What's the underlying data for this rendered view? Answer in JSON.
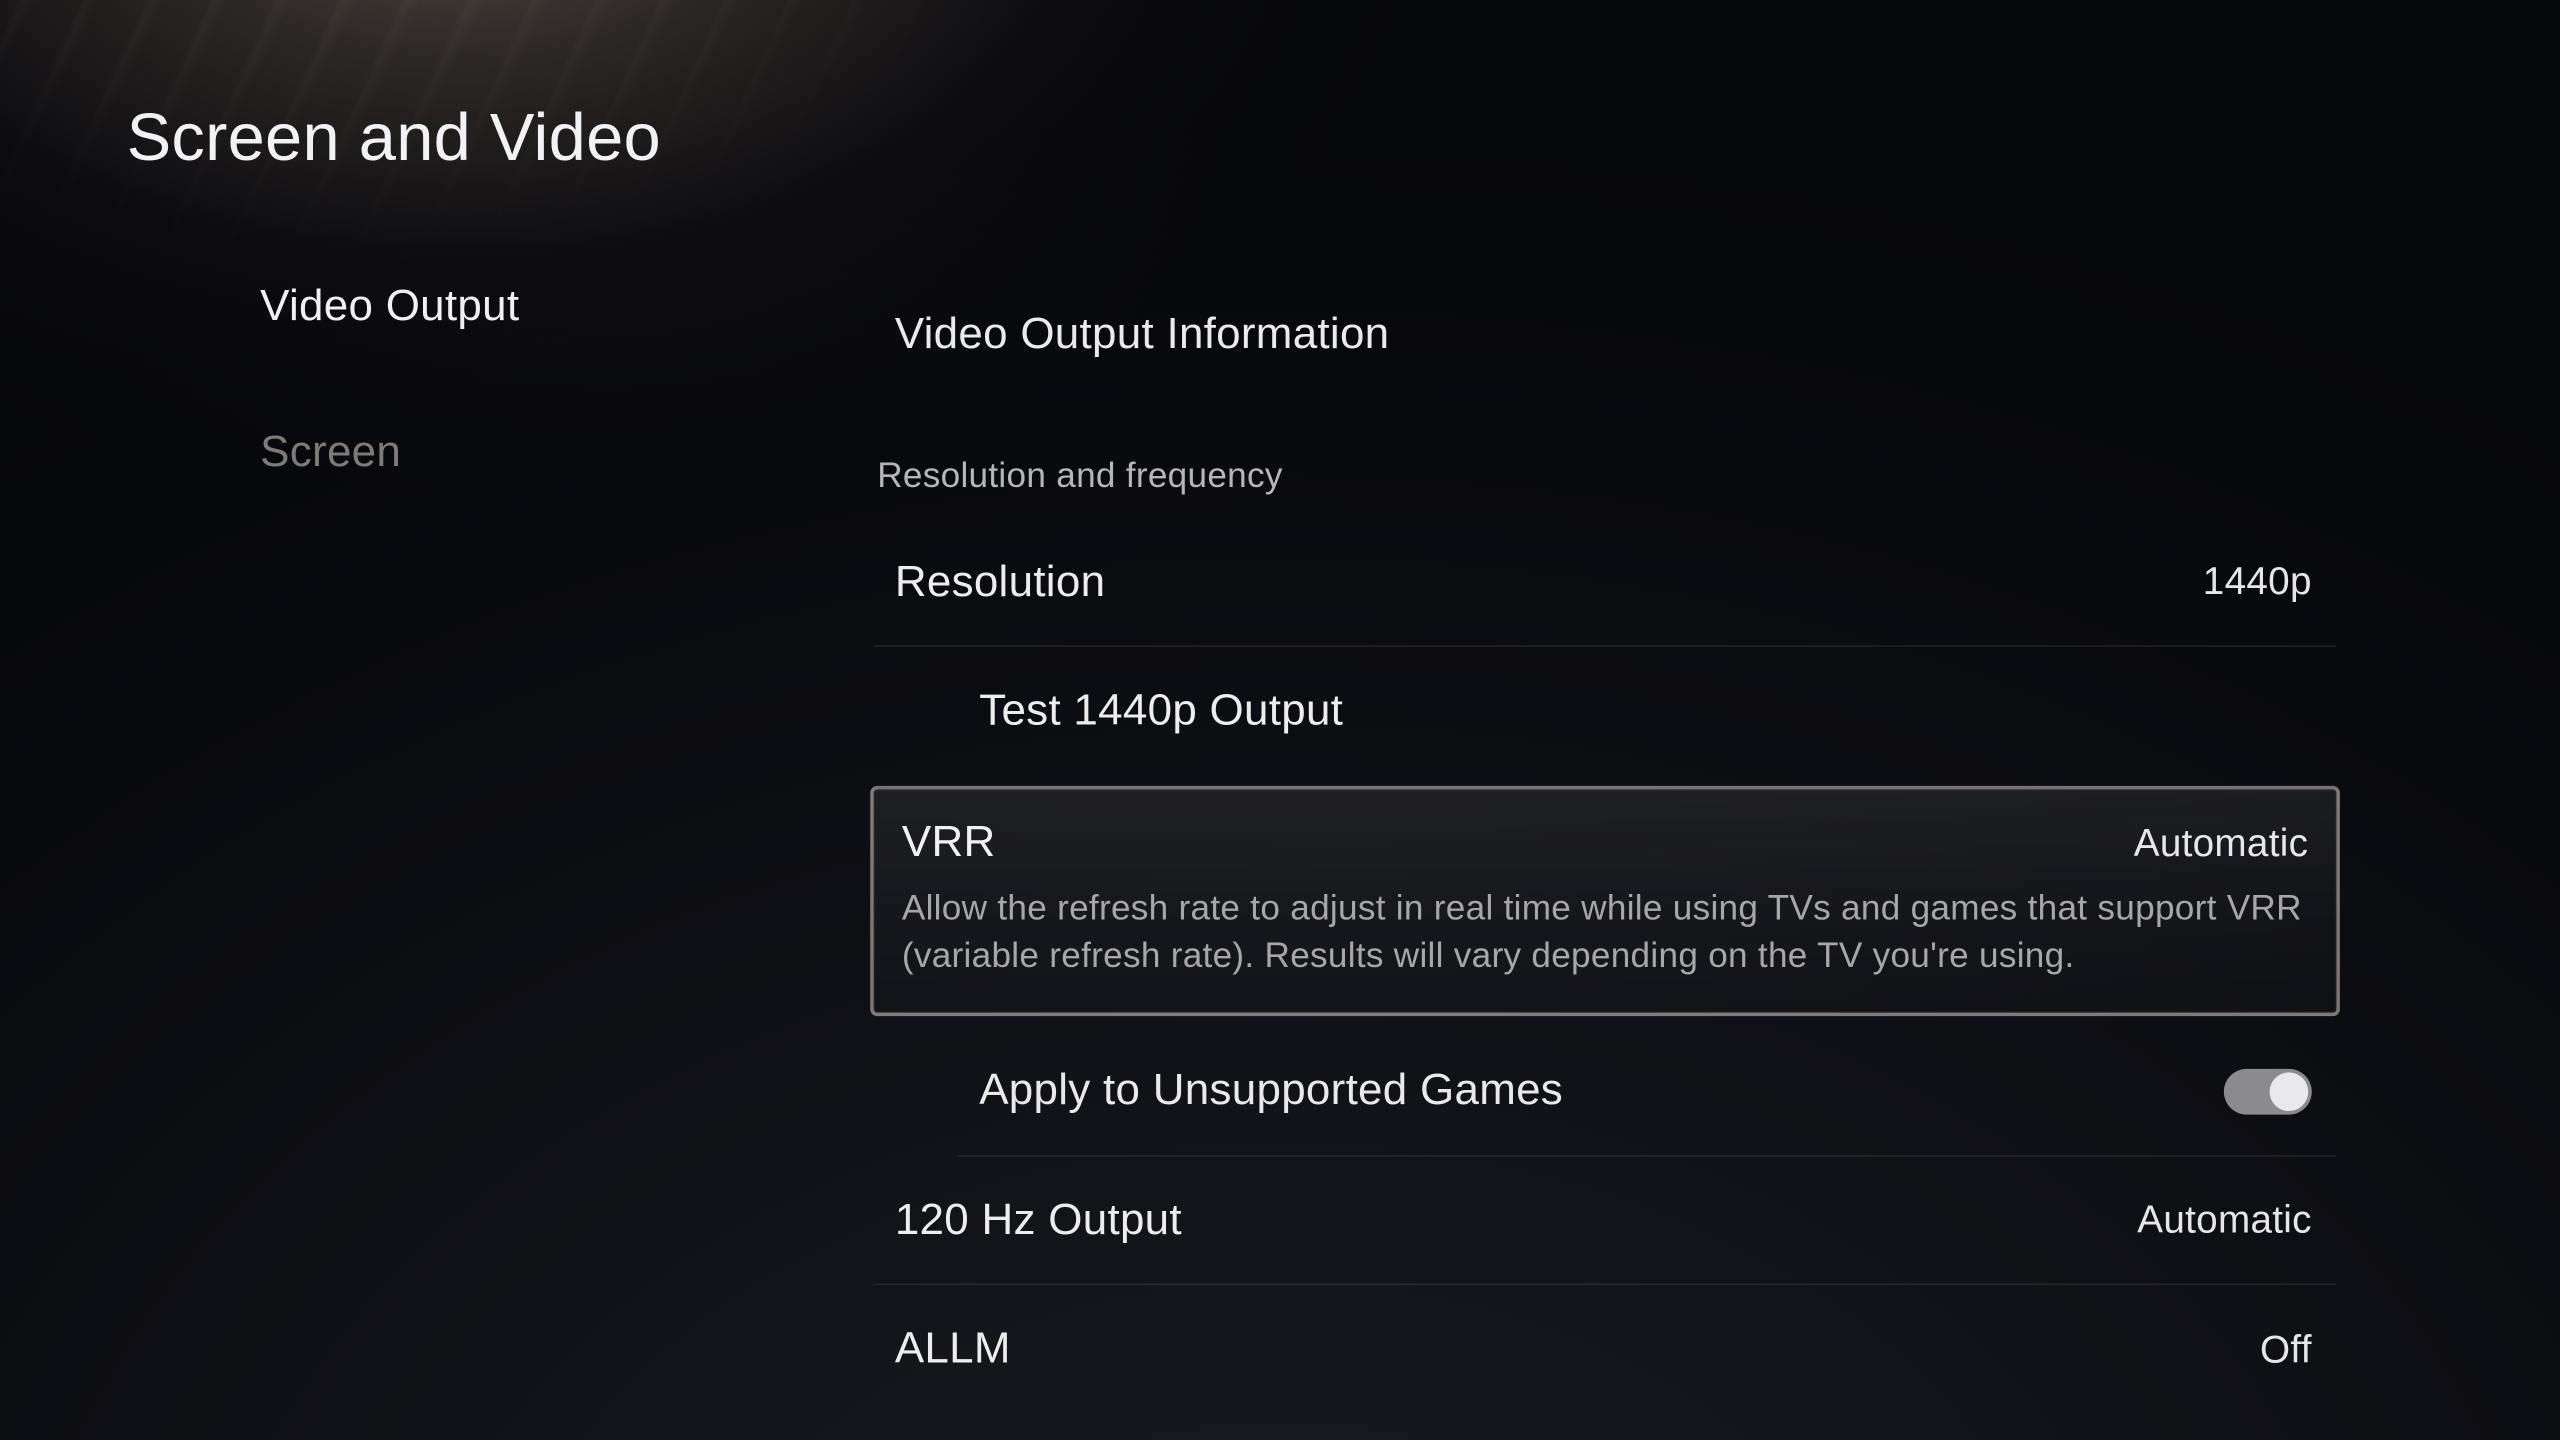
{
  "page": {
    "title": "Screen and Video"
  },
  "sidebar": {
    "items": [
      {
        "label": "Video Output",
        "active": true
      },
      {
        "label": "Screen",
        "active": false
      }
    ]
  },
  "content": {
    "header": {
      "label": "Video Output Information"
    },
    "section_label": "Resolution and frequency",
    "resolution": {
      "label": "Resolution",
      "value": "1440p"
    },
    "test_1440p": {
      "label": "Test 1440p Output"
    },
    "vrr": {
      "label": "VRR",
      "value": "Automatic",
      "description": "Allow the refresh rate to adjust in real time while using TVs and games that support VRR (variable refresh rate). Results will vary depending on the TV you're using."
    },
    "apply_unsupported": {
      "label": "Apply to Unsupported Games",
      "toggle_on": true
    },
    "hz120": {
      "label": "120 Hz Output",
      "value": "Automatic"
    },
    "allm": {
      "label": "ALLM",
      "value": "Off"
    }
  }
}
